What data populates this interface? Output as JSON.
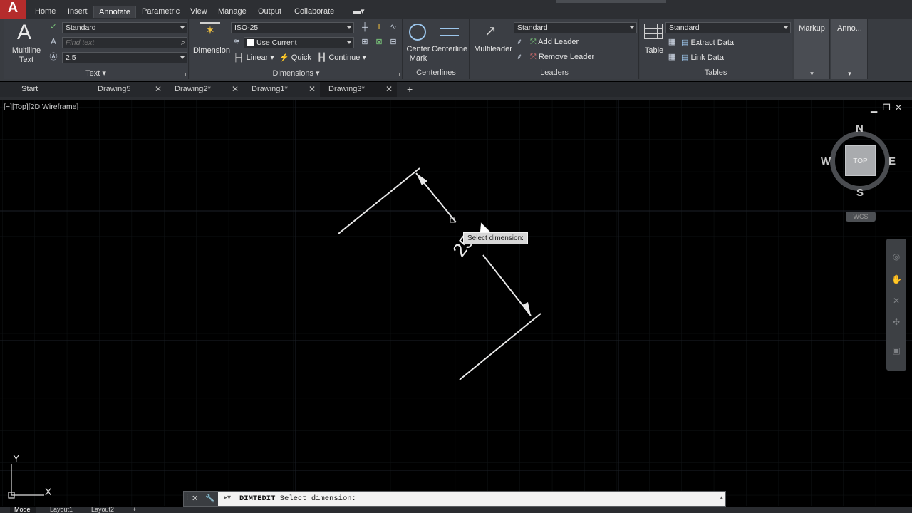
{
  "menu_tabs": [
    "Home",
    "Insert",
    "Annotate",
    "Parametric",
    "View",
    "Manage",
    "Output",
    "Collaborate"
  ],
  "ribbon": {
    "text_panel": {
      "multiline_label_1": "Multiline",
      "multiline_label_2": "Text",
      "style_value": "Standard",
      "find_placeholder": "Find text",
      "height_value": "2.5",
      "title": "Text"
    },
    "dimensions_panel": {
      "dimension_label": "Dimension",
      "style_value": "ISO-25",
      "layer_value": "Use Current",
      "linear_label": "Linear",
      "quick_label": "Quick",
      "continue_label": "Continue",
      "title": "Dimensions"
    },
    "centerlines_panel": {
      "center_mark_1": "Center",
      "center_mark_2": "Mark",
      "centerline_label": "Centerline",
      "title": "Centerlines"
    },
    "leaders_panel": {
      "multileader_label": "Multileader",
      "style_value": "Standard",
      "add_leader": "Add Leader",
      "remove_leader": "Remove Leader",
      "title": "Leaders"
    },
    "tables_panel": {
      "table_label": "Table",
      "style_value": "Standard",
      "extract_data": "Extract Data",
      "link_data": "Link Data",
      "title": "Tables"
    },
    "markup_label": "Markup",
    "anno_label": "Anno..."
  },
  "file_tabs": [
    {
      "label": "Start",
      "closable": false,
      "active": false
    },
    {
      "label": "Drawing5",
      "closable": true,
      "active": false
    },
    {
      "label": "Drawing2*",
      "closable": true,
      "active": false
    },
    {
      "label": "Drawing1*",
      "closable": true,
      "active": false
    },
    {
      "label": "Drawing3*",
      "closable": true,
      "active": true
    }
  ],
  "viewport": {
    "label": "[−][Top][2D Wireframe]",
    "tooltip": "Select dimension:",
    "dimension_text": "25",
    "viewcube": {
      "top": "TOP",
      "north": "N",
      "south": "S",
      "east": "E",
      "west": "W",
      "wcs": "WCS"
    },
    "ucs": {
      "y": "Y",
      "x": "X"
    }
  },
  "command_line": {
    "command": "DIMTEDIT",
    "prompt": "Select dimension:"
  },
  "status_tabs": [
    "Model",
    "Layout1",
    "Layout2"
  ],
  "colors": {
    "ribbon_bg": "#393c41",
    "viewport_bg": "#000000",
    "tooltip_bg": "#d7d7d7",
    "app_red": "#b52c2c"
  }
}
